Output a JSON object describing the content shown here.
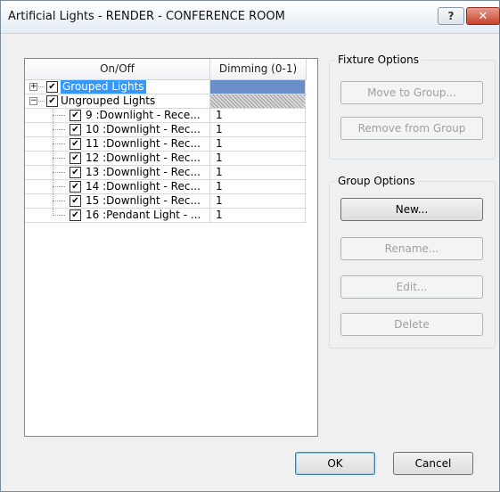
{
  "window": {
    "title": "Artificial Lights - RENDER - CONFERENCE ROOM",
    "help_label": "?",
    "close_label": "✕"
  },
  "tree": {
    "columns": [
      "On/Off",
      "Dimming (0-1)"
    ],
    "grouped": {
      "label": "Grouped Lights",
      "expander": "+",
      "checked": true
    },
    "ungrouped": {
      "label": "Ungrouped Lights",
      "expander": "−",
      "checked": true
    },
    "items": [
      {
        "label": "9 :Downlight - Rece...",
        "dimming": "1"
      },
      {
        "label": "10 :Downlight - Rec...",
        "dimming": "1"
      },
      {
        "label": "11 :Downlight - Rec...",
        "dimming": "1"
      },
      {
        "label": "12 :Downlight - Rec...",
        "dimming": "1"
      },
      {
        "label": "13 :Downlight - Rec...",
        "dimming": "1"
      },
      {
        "label": "14 :Downlight - Rec...",
        "dimming": "1"
      },
      {
        "label": "15 :Downlight - Rec...",
        "dimming": "1"
      },
      {
        "label": "16 :Pendant Light - ...",
        "dimming": "1"
      }
    ],
    "check_glyph": "✔"
  },
  "fixture_options": {
    "title": "Fixture Options",
    "move_to_group": "Move to Group...",
    "remove_from_group": "Remove from Group"
  },
  "group_options": {
    "title": "Group Options",
    "new": "New...",
    "rename": "Rename...",
    "edit": "Edit...",
    "delete": "Delete"
  },
  "footer": {
    "ok": "OK",
    "cancel": "Cancel"
  }
}
